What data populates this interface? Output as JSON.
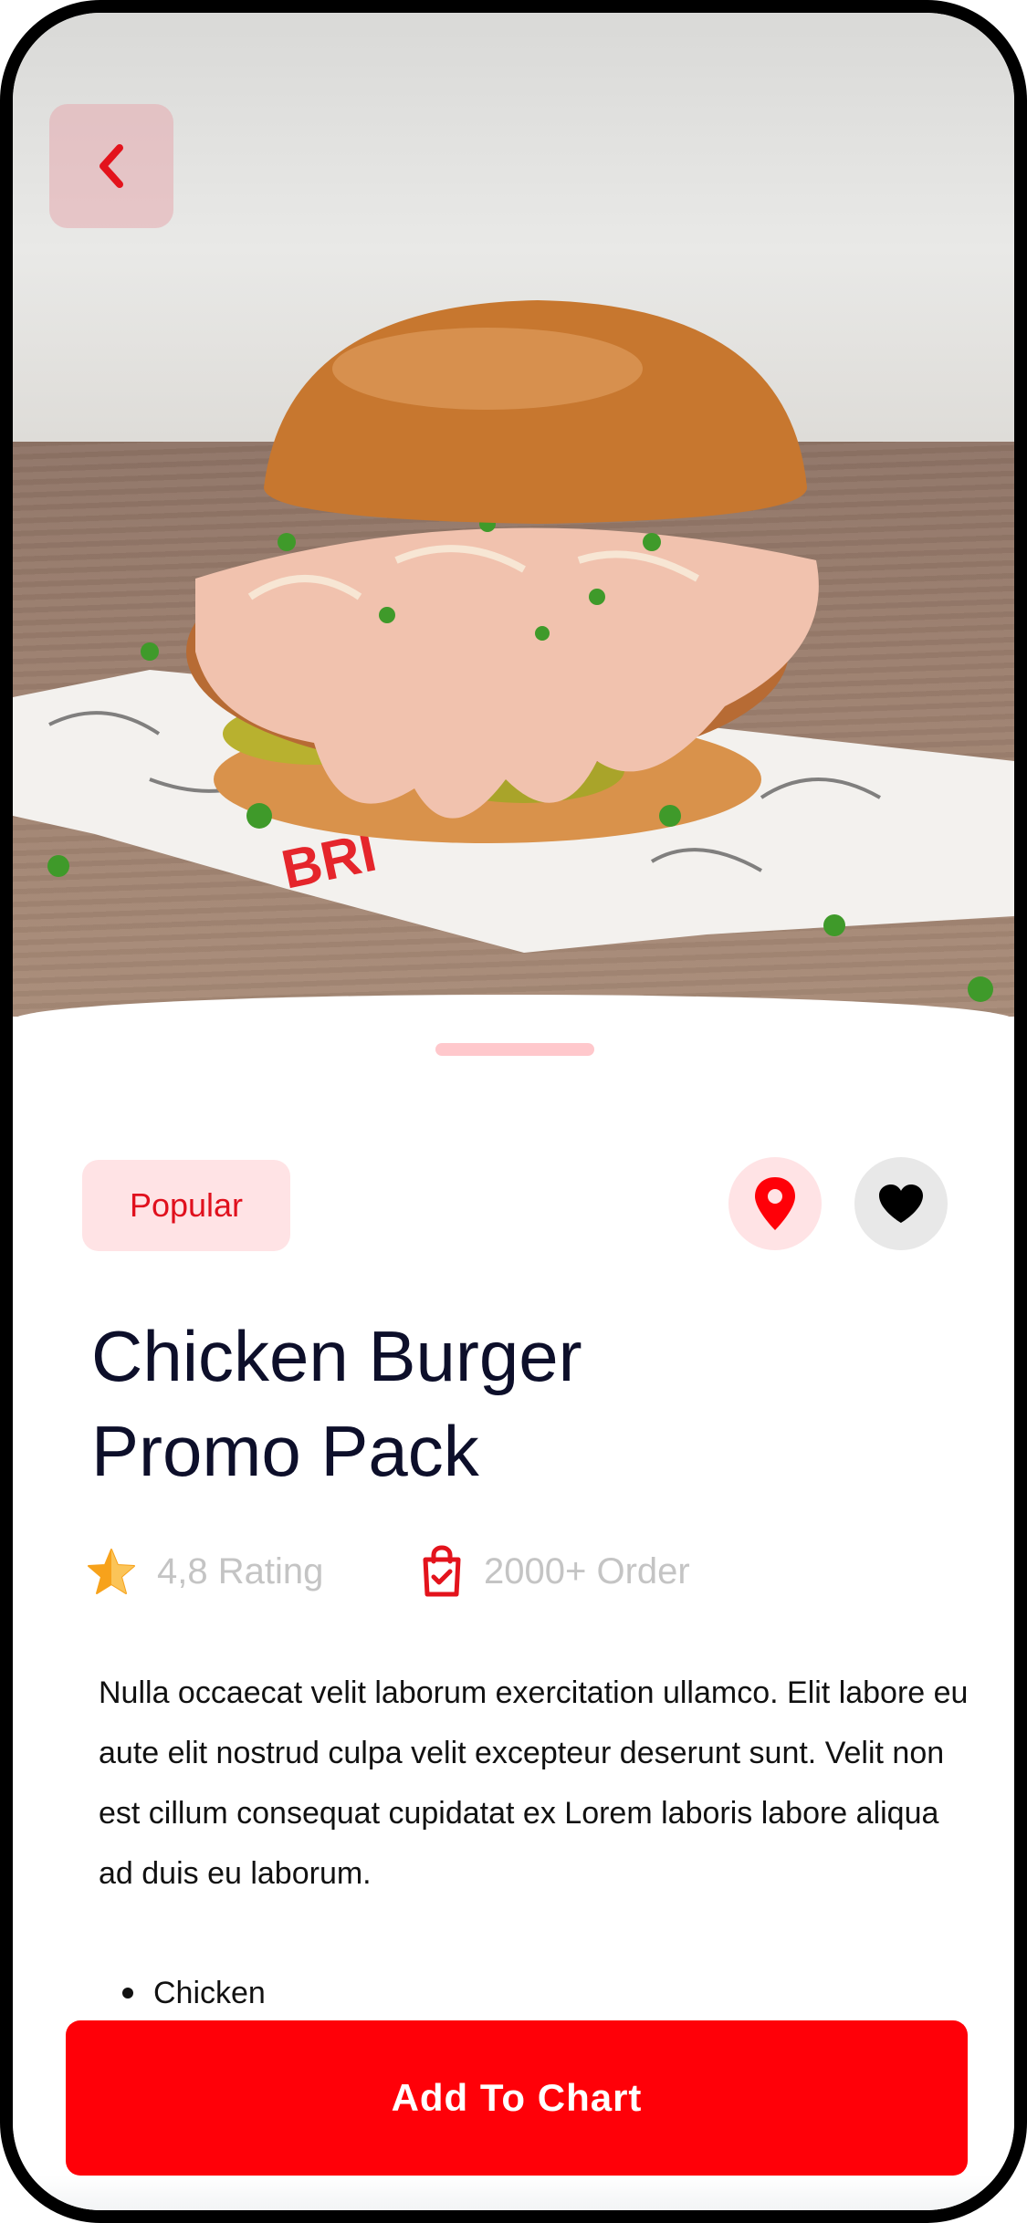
{
  "product": {
    "badge": "Popular",
    "title_line1": "Chicken Burger",
    "title_line2": "Promo Pack",
    "rating_text": "4,8 Rating",
    "orders_text": "2000+ Order",
    "description": "Nulla occaecat velit laborum exercitation ullamco. Elit labore eu aute elit nostrud culpa velit excepteur deserunt sunt. Velit non est cillum consequat cupidatat ex Lorem laboris labore aliqua ad duis eu laborum.",
    "ingredients": [
      "Chicken"
    ]
  },
  "actions": {
    "add_to_cart_label": "Add To Chart"
  },
  "icons": {
    "back": "chevron-left-icon",
    "location": "location-pin-icon",
    "favorite": "heart-icon",
    "rating": "star-icon",
    "orders": "shopping-bag-icon"
  },
  "colors": {
    "accent": "#ff0008",
    "accent_light": "#ffe3e5",
    "title": "#0d0f2a",
    "muted": "#c4c4c4",
    "star": "#f7a21b"
  },
  "hero_image": "chicken burger on patterned paper"
}
